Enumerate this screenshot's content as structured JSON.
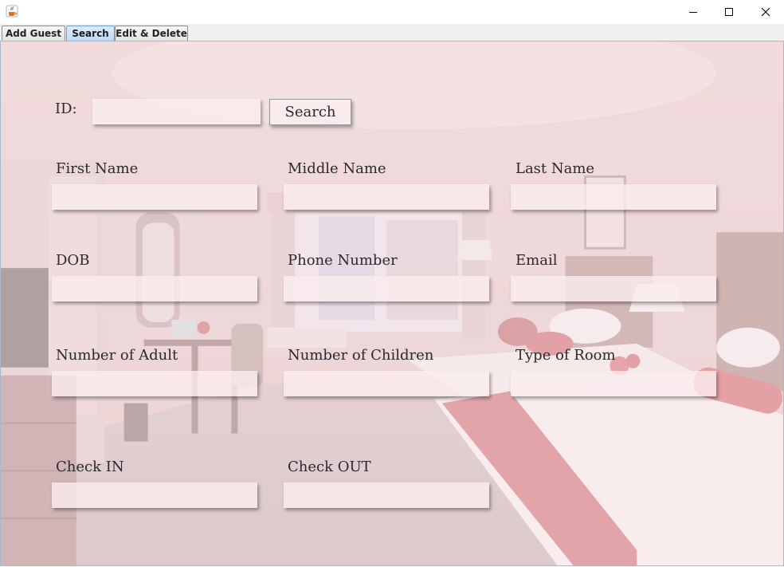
{
  "window": {
    "min_icon": "minimize-icon",
    "max_icon": "maximize-icon",
    "close_icon": "close-icon"
  },
  "tabs": [
    {
      "label": "Add Guest",
      "selected": false
    },
    {
      "label": "Search",
      "selected": true
    },
    {
      "label": "Edit & Delete",
      "selected": false
    }
  ],
  "search": {
    "id_label": "ID:",
    "id_value": "",
    "button_label": "Search"
  },
  "form": {
    "first_name": {
      "label": "First Name",
      "value": ""
    },
    "middle_name": {
      "label": "Middle Name",
      "value": ""
    },
    "last_name": {
      "label": "Last Name",
      "value": ""
    },
    "dob": {
      "label": "DOB",
      "value": ""
    },
    "phone": {
      "label": "Phone Number",
      "value": ""
    },
    "email": {
      "label": "Email",
      "value": ""
    },
    "adults": {
      "label": "Number of Adult",
      "value": ""
    },
    "children": {
      "label": "Number of Children",
      "value": ""
    },
    "room_type": {
      "label": "Type of Room",
      "value": ""
    },
    "check_in": {
      "label": "Check IN",
      "value": ""
    },
    "check_out": {
      "label": "Check OUT",
      "value": ""
    }
  },
  "colors": {
    "selected_tab": "#bcd9f5",
    "field_bg": "#faecee",
    "accent_red": "#c0404a"
  }
}
